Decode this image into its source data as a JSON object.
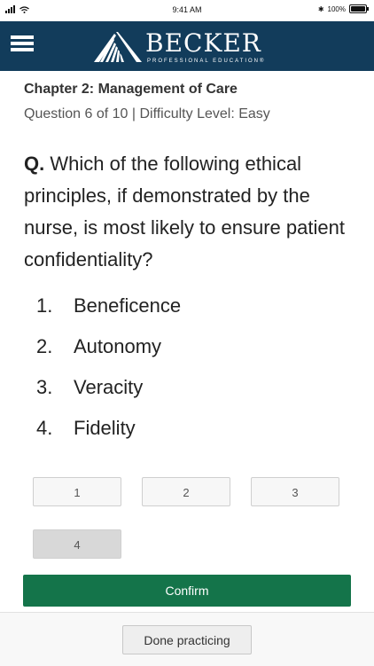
{
  "status_bar": {
    "time": "9:41 AM",
    "battery": "100%"
  },
  "header": {
    "brand": "BECKER",
    "tagline": "PROFESSIONAL EDUCATION®"
  },
  "quiz": {
    "chapter": "Chapter 2: Management of Care",
    "meta": "Question 6 of 10 | Difficulty Level: Easy",
    "q_prefix": "Q.",
    "question": "Which of the following ethical principles, if demonstrated by the nurse, is most likely to ensure patient confidentiality?",
    "answers": [
      {
        "num": "1.",
        "text": "Beneficence"
      },
      {
        "num": "2.",
        "text": "Autonomy"
      },
      {
        "num": "3.",
        "text": "Veracity"
      },
      {
        "num": "4.",
        "text": "Fidelity"
      }
    ],
    "choices": [
      "1",
      "2",
      "3",
      "4"
    ],
    "confirm_label": "Confirm"
  },
  "footer": {
    "done_label": "Done practicing"
  }
}
